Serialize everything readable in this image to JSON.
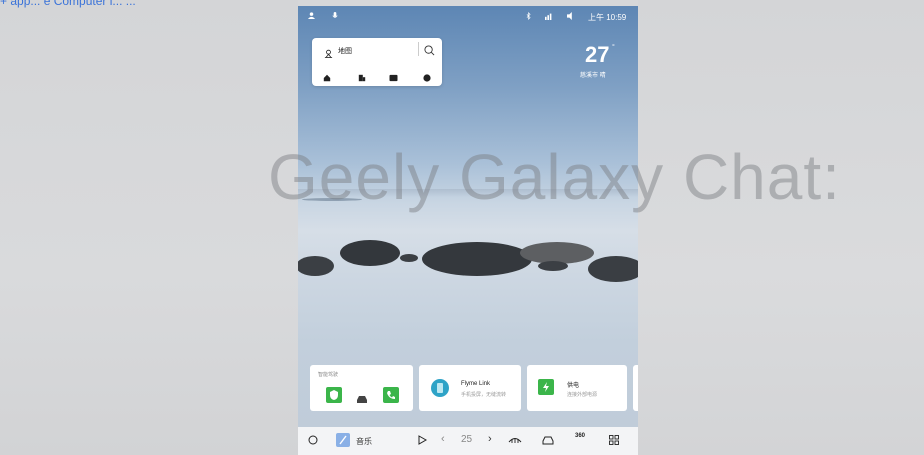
{
  "top_link": {
    "text": "+ app... e Computer i... ..."
  },
  "watermark": {
    "text": "Geely Galaxy Chat:"
  },
  "statusbar": {
    "time": "上午 10:59"
  },
  "map_widget": {
    "title": "地图",
    "icons": [
      "home-icon",
      "company-icon",
      "parking-icon",
      "food-icon"
    ]
  },
  "weather": {
    "temperature": "27",
    "unit": "°",
    "location": "慈溪市 晴"
  },
  "cards": [
    {
      "title": "智能驾驶",
      "icons": [
        "shield-icon",
        "car-icon",
        "phone-icon"
      ]
    },
    {
      "title": "Flyme Link",
      "subtitle": "手机投屏，无缝流转"
    },
    {
      "title": "供电",
      "subtitle": "连接外部电源"
    }
  ],
  "dock": {
    "music_label": "音乐",
    "temperature": "25",
    "icons": [
      "home-circle-icon",
      "music-icon",
      "play-icon",
      "chevron-left-icon",
      "chevron-right-icon",
      "defrost-icon",
      "car-icon",
      "view-360-icon",
      "apps-icon"
    ],
    "view_360_label": "360"
  },
  "colors": {
    "accent_green": "#3bb54a",
    "accent_blue": "#3a73d9",
    "dock_bg": "#f3f4f6"
  }
}
